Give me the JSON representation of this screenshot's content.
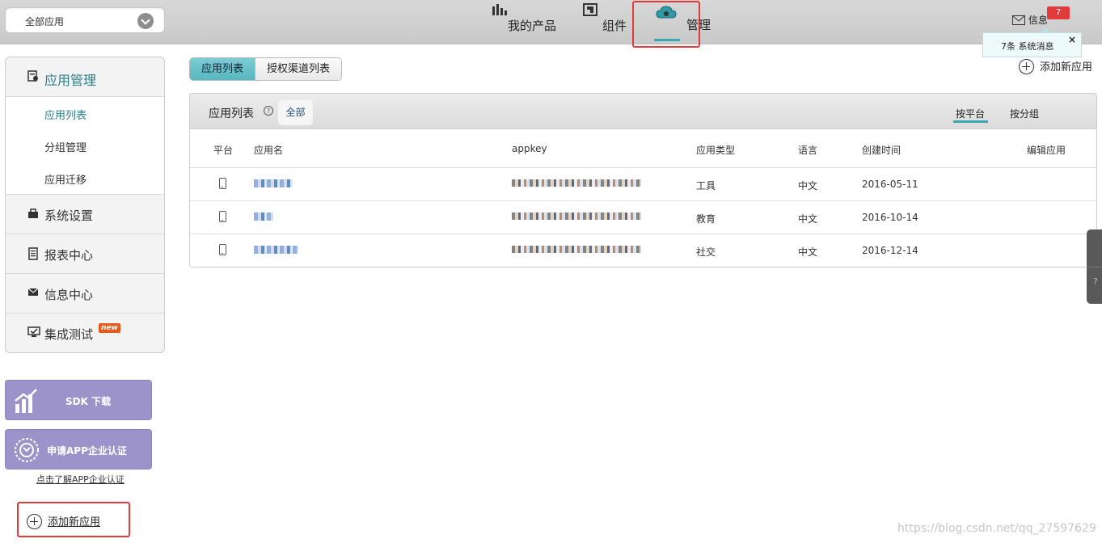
{
  "topbar": {
    "app_select": "全部应用",
    "nav": {
      "products": "我的产品",
      "components": "组件",
      "manage": "管理"
    },
    "messages_label": "信息",
    "messages_badge": "7",
    "popup_text": "7条 系统消息",
    "popup_close": "×"
  },
  "add_app_top": "添加新应用",
  "sidebar": {
    "app_manage": "应用管理",
    "sub": [
      "应用列表",
      "分组管理",
      "应用迁移"
    ],
    "system_settings": "系统设置",
    "report_center": "报表中心",
    "info_center": "信息中心",
    "integration_test": "集成测试",
    "new_tag": "new"
  },
  "promo": {
    "sdk": "SDK 下载",
    "cert": "申请APP企业认证",
    "cert_link": "点击了解APP企业认证",
    "add_app": "添加新应用"
  },
  "tabs": [
    "应用列表",
    "授权渠道列表"
  ],
  "panel": {
    "title": "应用列表",
    "help": "?",
    "filter_all": "全部",
    "by_platform": "按平台",
    "by_group": "按分组",
    "columns": {
      "platform": "平台",
      "name": "应用名",
      "appkey": "appkey",
      "type": "应用类型",
      "lang": "语言",
      "created": "创建时间",
      "edit": "编辑应用"
    },
    "rows": [
      {
        "type": "工具",
        "lang": "中文",
        "created": "2016-05-11"
      },
      {
        "type": "教育",
        "lang": "中文",
        "created": "2016-10-14"
      },
      {
        "type": "社交",
        "lang": "中文",
        "created": "2016-12-14"
      }
    ]
  },
  "side_float_help": "?",
  "watermark": "https://blog.csdn.net/qq_27597629"
}
